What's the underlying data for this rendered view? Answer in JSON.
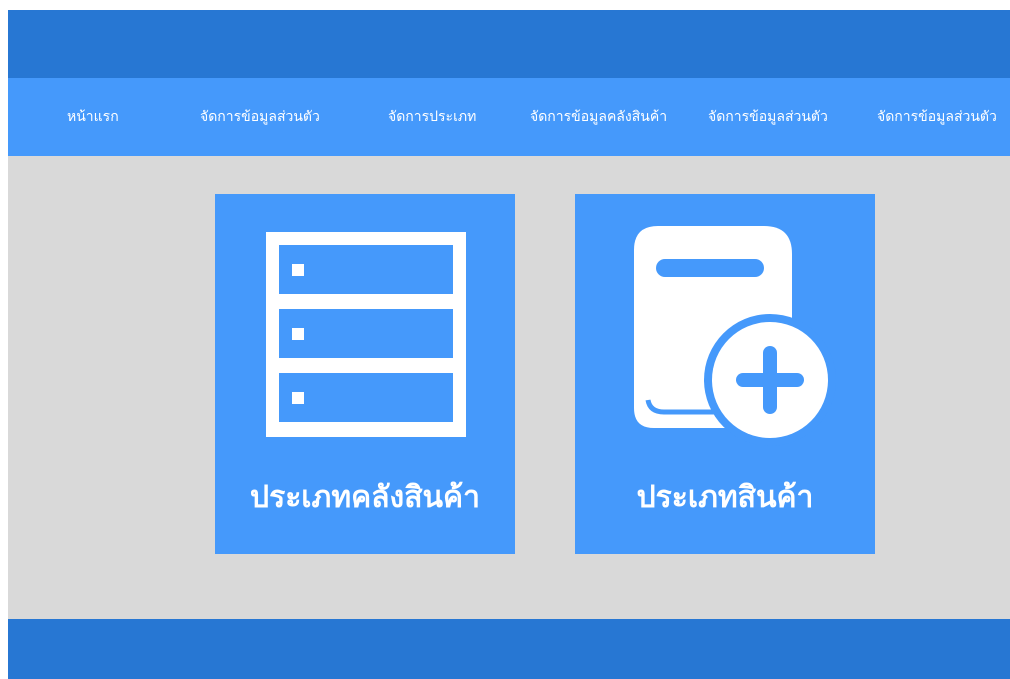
{
  "colors": {
    "header_dark": "#2777d3",
    "nav_blue": "#4599fb",
    "card_blue": "#4599fb",
    "background_gray": "#d9d9d9",
    "text_white": "#ffffff"
  },
  "nav": {
    "items": [
      {
        "label": "หน้าแรก"
      },
      {
        "label": "จัดการข้อมูลส่วนตัว"
      },
      {
        "label": "จัดการประเภท"
      },
      {
        "label": "จัดการข้อมูลคลังสินค้า"
      },
      {
        "label": "จัดการข้อมูลส่วนตัว"
      },
      {
        "label": "จัดการข้อมูลส่วนตัว"
      }
    ]
  },
  "cards": [
    {
      "label": "ประเภทคลังสินค้า",
      "icon": "warehouse-shelves-icon"
    },
    {
      "label": "ประเภทสินค้า",
      "icon": "device-add-icon"
    }
  ]
}
